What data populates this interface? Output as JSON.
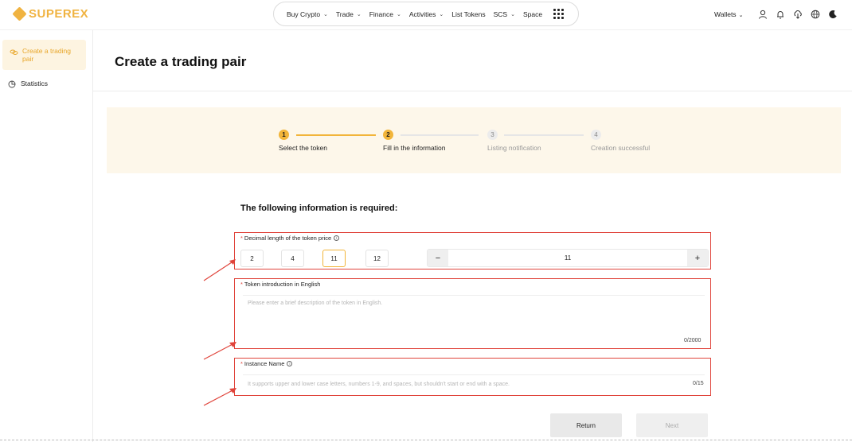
{
  "brand": {
    "name": "SUPEREX",
    "color": "#f0b341"
  },
  "nav": {
    "items": [
      {
        "label": "Buy Crypto",
        "dropdown": true
      },
      {
        "label": "Trade",
        "dropdown": true
      },
      {
        "label": "Finance",
        "dropdown": true
      },
      {
        "label": "Activities",
        "dropdown": true
      },
      {
        "label": "List Tokens",
        "dropdown": false
      },
      {
        "label": "SCS",
        "dropdown": true
      },
      {
        "label": "Space",
        "dropdown": false
      }
    ],
    "apps_icon": "grid-icon"
  },
  "top_right": {
    "wallets_label": "Wallets",
    "icons": [
      "user-icon",
      "bell-icon",
      "download-icon",
      "globe-icon",
      "moon-icon"
    ]
  },
  "sidebar": {
    "items": [
      {
        "label": "Create a trading pair",
        "icon": "coins-icon",
        "active": true
      },
      {
        "label": "Statistics",
        "icon": "pie-chart-icon",
        "active": false
      }
    ]
  },
  "page": {
    "title": "Create a trading pair"
  },
  "stepper": {
    "steps": [
      {
        "num": "1",
        "label": "Select the token",
        "state": "done"
      },
      {
        "num": "2",
        "label": "Fill in the information",
        "state": "current"
      },
      {
        "num": "3",
        "label": "Listing notification",
        "state": "todo"
      },
      {
        "num": "4",
        "label": "Creation successful",
        "state": "todo"
      }
    ]
  },
  "form": {
    "section_title": "The following information is required:",
    "decimal": {
      "label": "Decimal length of the token price",
      "required_mark": "*",
      "options": [
        "2",
        "4",
        "11",
        "12"
      ],
      "selected": "11",
      "stepper_value": "11",
      "minus": "−",
      "plus": "+"
    },
    "intro": {
      "label": "Token introduction in English",
      "required_mark": "*",
      "placeholder": "Please enter a brief description of the token in English.",
      "counter": "0/2000"
    },
    "instance": {
      "label": "Instance Name",
      "required_mark": "*",
      "placeholder": "It supports upper and lower case letters, numbers 1-9, and spaces, but shouldn't start or end with a space.",
      "counter": "0/15"
    }
  },
  "actions": {
    "return_label": "Return",
    "next_label": "Next"
  },
  "colors": {
    "accent": "#f2b53a",
    "highlight": "#e0443b",
    "band": "#fdf7ea"
  }
}
